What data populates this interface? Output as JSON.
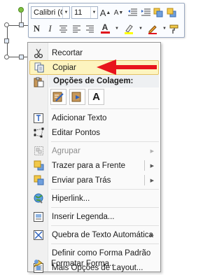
{
  "mini_toolbar": {
    "font_name": "Calibri (C",
    "font_size": "11",
    "grow_font": "A",
    "shrink_font": "A",
    "bold": "N",
    "italic": "I",
    "font_color_letter": "A"
  },
  "context_menu": {
    "cut": "Recortar",
    "copy": "Copiar",
    "paste_options_header": "Opções de Colagem:",
    "paste_keep_text": "A",
    "add_text": "Adicionar Texto",
    "edit_points": "Editar Pontos",
    "group": "Agrupar",
    "bring_to_front": "Trazer para a Frente",
    "send_to_back": "Enviar para Trás",
    "hyperlink": "Hiperlink...",
    "insert_caption": "Inserir Legenda...",
    "wrap_text": "Quebra de Texto Automática",
    "set_default_shape": "Definir como Forma Padrão",
    "more_layout_options": "Mais Opções de Layout...",
    "format_shape": "Formatar Forma..."
  },
  "colors": {
    "highlight": "#fdf4bf",
    "annotation_arrow": "#e8141c",
    "font_color": "#e0141c",
    "highlighter": "#ffff00",
    "fill": "#f0a030"
  }
}
